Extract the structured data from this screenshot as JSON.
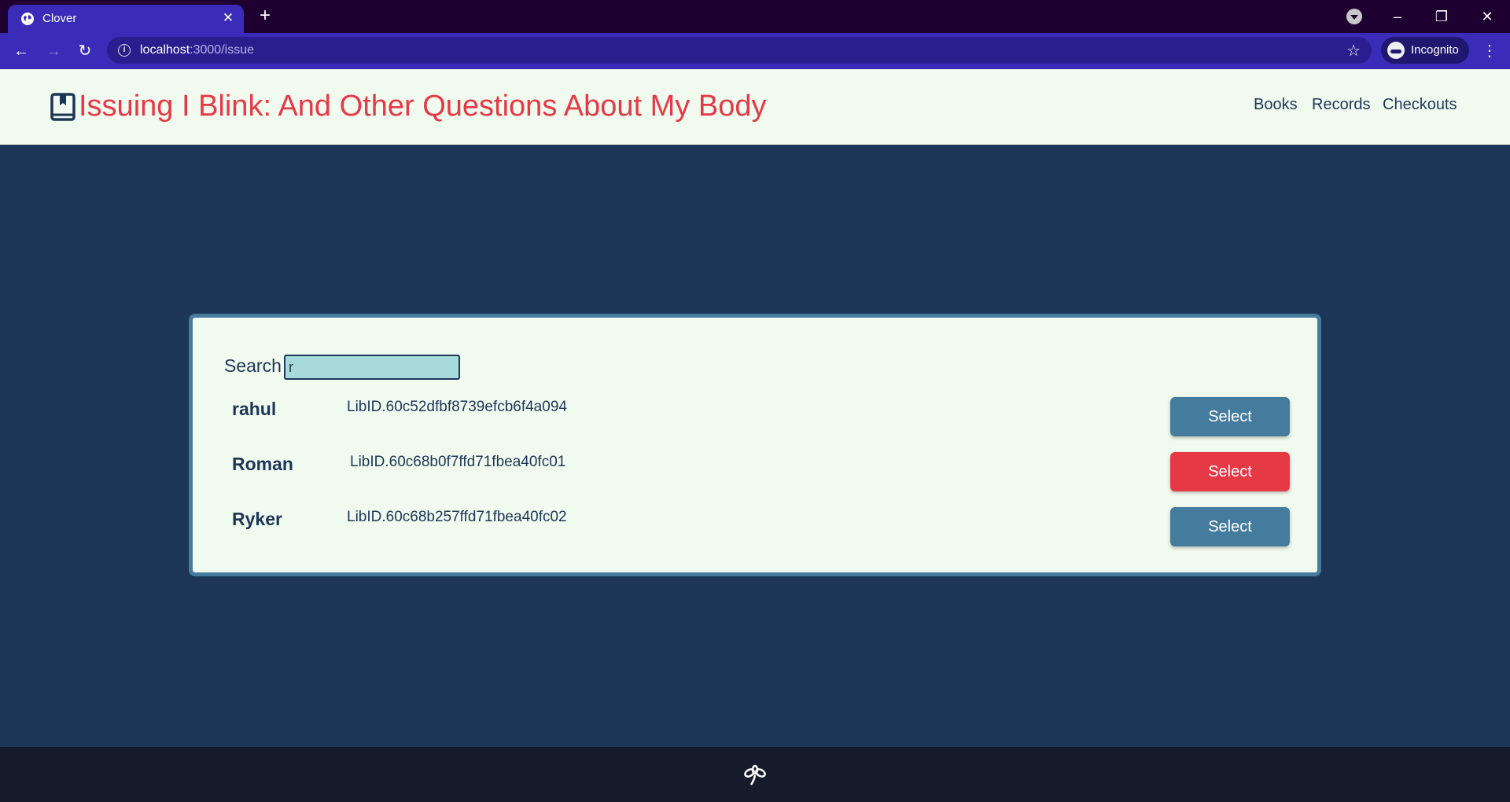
{
  "browser": {
    "tab_title": "Clover",
    "url_host": "localhost",
    "url_path": ":3000/issue",
    "profile_label": "Incognito"
  },
  "header": {
    "title": "Issuing I Blink: And Other Questions About My Body",
    "nav": [
      "Books",
      "Records",
      "Checkouts"
    ]
  },
  "search": {
    "label": "Search",
    "value": "r"
  },
  "results": [
    {
      "name": "rahul",
      "libid": "LibID.60c52dfbf8739efcb6f4a094",
      "button": "Select",
      "button_color": "#457b9d"
    },
    {
      "name": "Roman",
      "libid": "LibID.60c68b0f7ffd71fbea40fc01",
      "button": "Select",
      "button_color": "#e63946"
    },
    {
      "name": "Ryker",
      "libid": "LibID.60c68b257ffd71fbea40fc02",
      "button": "Select",
      "button_color": "#457b9d"
    }
  ],
  "colors": {
    "primary": "#1d3557",
    "accent": "#e63946",
    "surface": "#f1faee",
    "button": "#457b9d",
    "input": "#a8dadc"
  }
}
